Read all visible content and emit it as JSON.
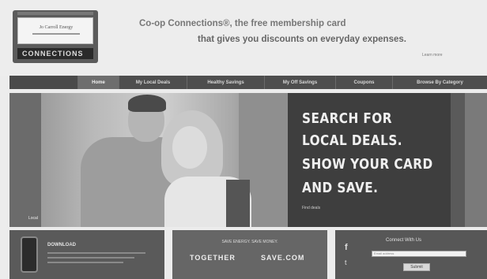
{
  "header": {
    "card_name": "Jo Carroll Energy",
    "card_logo": "CONNECTIONS",
    "tagline_line1": "Co-op Connections®, the free membership card",
    "tagline_line2": "that gives you discounts on everyday expenses.",
    "learn_more": "Learn more"
  },
  "nav": {
    "items": [
      {
        "label": "Home",
        "active": true
      },
      {
        "label": "My Local Deals",
        "active": false
      },
      {
        "label": "Healthy Savings",
        "active": false
      },
      {
        "label": "My Off Savings",
        "active": false
      },
      {
        "label": "Coupons",
        "active": false
      },
      {
        "label": "Browse By Category",
        "active": false
      }
    ]
  },
  "hero": {
    "line1": "SEARCH FOR",
    "line2": "LOCAL DEALS.",
    "line3": "SHOW YOUR CARD",
    "line4": "AND SAVE.",
    "small": "Find deals",
    "caption": "Local"
  },
  "panels": {
    "app": {
      "title": "DOWNLOAD"
    },
    "promo": {
      "small": "SAVE ENERGY. SAVE MONEY.",
      "word1": "TOGETHER",
      "word2": "SAVE.COM"
    },
    "connect": {
      "title": "Connect With Us",
      "facebook": "f",
      "twitter": "t",
      "input_placeholder": "Email address",
      "button": "Submit"
    }
  },
  "colors": {
    "nav_bg": "#4e4e4e",
    "nav_active": "#6e6e6e",
    "hero_text_bg": "#3e3e3e"
  }
}
